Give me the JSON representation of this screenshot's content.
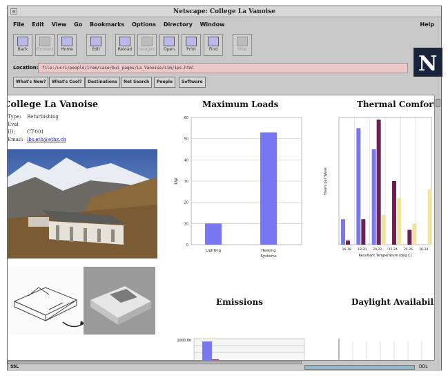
{
  "window": {
    "title": "Netscape: College La Vanoise"
  },
  "menu": {
    "items": [
      "File",
      "Edit",
      "View",
      "Go",
      "Bookmarks",
      "Options",
      "Directory",
      "Window"
    ],
    "help": "Help"
  },
  "toolbar": {
    "buttons": [
      {
        "label": "Back",
        "enabled": true,
        "icon": "back-arrow-icon"
      },
      {
        "label": "Forward",
        "enabled": false,
        "icon": "forward-arrow-icon"
      },
      {
        "label": "Home",
        "enabled": true,
        "icon": "home-icon"
      },
      {
        "label": "Edit",
        "enabled": true,
        "icon": "edit-icon"
      },
      {
        "label": "Reload",
        "enabled": true,
        "icon": "reload-icon"
      },
      {
        "label": "Images",
        "enabled": false,
        "icon": "images-icon"
      },
      {
        "label": "Open",
        "enabled": true,
        "icon": "open-icon"
      },
      {
        "label": "Print",
        "enabled": true,
        "icon": "print-icon"
      },
      {
        "label": "Find",
        "enabled": true,
        "icon": "find-icon"
      },
      {
        "label": "Stop",
        "enabled": false,
        "icon": "stop-icon"
      }
    ]
  },
  "location": {
    "label": "Location:",
    "url": "file:/usr1/people/irem/case/bui_pages/La_Vanoise/sim/1ps.html"
  },
  "directory_buttons": [
    "What's New?",
    "What's Cool?",
    "Destinations",
    "Net Search",
    "People",
    "Software"
  ],
  "page": {
    "heading": "College La Vanoise",
    "info": [
      {
        "key": "Type:",
        "value": "Refurbishing"
      },
      {
        "key": "Eval ID:",
        "value": "CT-001"
      },
      {
        "key": "Email:",
        "value": "lbs.eth@ethz.ch"
      }
    ]
  },
  "charts": {
    "max_loads_title": "Maximum Loads",
    "thermal_title": "Thermal Comfort",
    "emissions_title": "Emissions",
    "daylight_title": "Daylight Availability"
  },
  "chart_data": [
    {
      "type": "bar",
      "title": "Maximum Loads",
      "categories": [
        "Lighting",
        "Heating Systems"
      ],
      "values": [
        10,
        53
      ],
      "ylim": [
        0,
        60
      ],
      "yticks": [
        0,
        10,
        20,
        30,
        40,
        50,
        60
      ],
      "ylabel": "kW",
      "color": "#7878f0",
      "grid": true
    },
    {
      "type": "bar",
      "title": "Thermal Comfort",
      "categories": [
        "16-18",
        "18-20",
        "20-22",
        "22-24",
        "24-26",
        "26-28"
      ],
      "xlabel": "Resultant Temperature (deg C)",
      "ylabel": "Hours per Week",
      "ylim": [
        0,
        60
      ],
      "series": [
        {
          "values": [
            12,
            55,
            45,
            0,
            0,
            0
          ],
          "color": "#7878f0"
        },
        {
          "values": [
            2,
            12,
            59,
            30,
            7,
            0
          ],
          "color": "#6e2050"
        },
        {
          "values": [
            0,
            0,
            14,
            22,
            10,
            26
          ],
          "color": "#f0e2a0"
        }
      ],
      "grid": true
    },
    {
      "type": "bar",
      "title": "Emissions",
      "ytick_top": "1000.00",
      "color": "#7878f0"
    },
    {
      "type": "bar",
      "title": "Daylight Availability"
    }
  ],
  "colors": {
    "bar_blue": "#7878f0",
    "bar_purple": "#6e2050",
    "bar_yellow": "#f0e2a0",
    "location_bg": "#ecc8c8"
  },
  "statusbar": {
    "left": "SSL",
    "right": "DDL"
  }
}
